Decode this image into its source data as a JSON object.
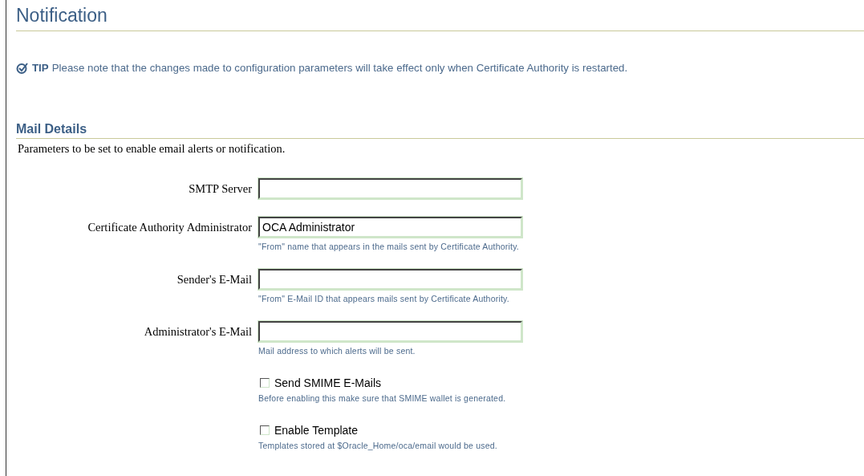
{
  "page_title": "Notification",
  "tip": {
    "label": "TIP",
    "text": "Please note that the changes made to configuration parameters will take effect only when Certificate Authority is restarted."
  },
  "section": {
    "title": "Mail Details",
    "description": "Parameters to be set to enable email alerts or notification."
  },
  "fields": [
    {
      "kind": "text",
      "label": "SMTP Server"
    },
    {
      "kind": "text",
      "label": "Certificate Authority Administrator",
      "value": "OCA Administrator",
      "hint": "\"From\" name that appears in the mails sent by Certificate Authority."
    },
    {
      "kind": "text",
      "label": "Sender's E-Mail",
      "hint": "\"From\" E-Mail ID that appears mails sent by Certificate Authority."
    },
    {
      "kind": "text",
      "label": "Administrator's E-Mail",
      "hint": "Mail address to which alerts will be sent."
    },
    {
      "kind": "checkbox",
      "label": "Send SMIME E-Mails",
      "checked": false,
      "hint": "Before enabling this make sure that SMIME wallet is generated."
    },
    {
      "kind": "checkbox",
      "label": "Enable Template",
      "checked": false,
      "hint": "Templates stored at $Oracle_Home/oca/email would be used."
    }
  ]
}
